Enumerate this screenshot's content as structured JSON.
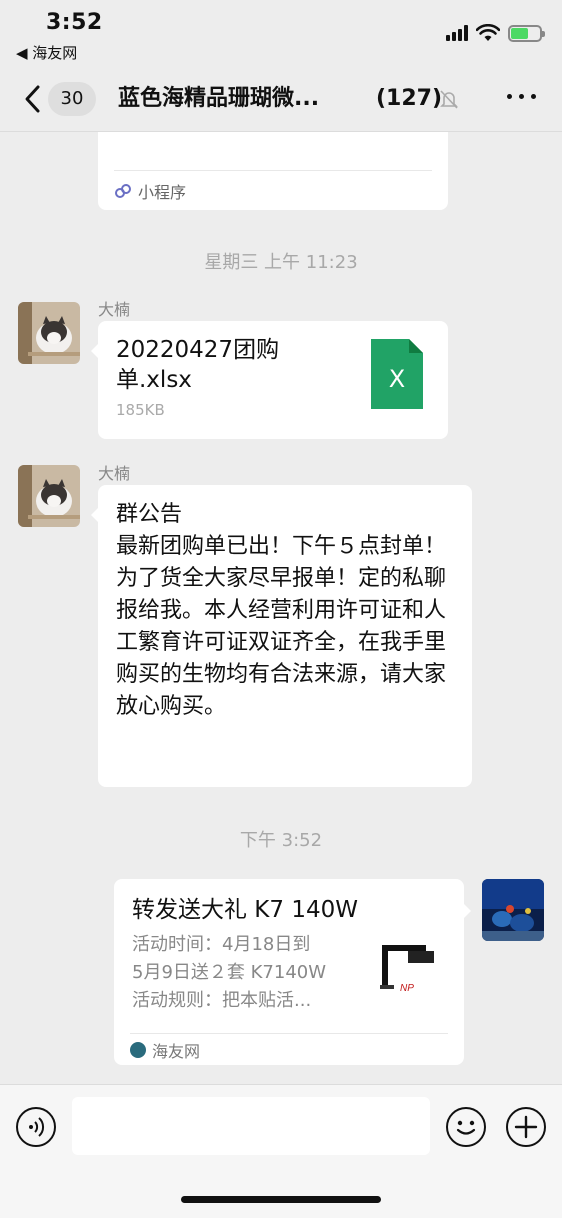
{
  "status_bar": {
    "time": "3:52",
    "back_app": "◀ 海友网"
  },
  "nav": {
    "unread_count": "30",
    "title": "蓝色海精品珊瑚微...",
    "member_count": "(127)"
  },
  "messages": {
    "mini_program_label": "小程序",
    "timestamp_1": "星期三 上午 11:23",
    "file_msg": {
      "sender": "大楠",
      "file_name": "20220427团购单.xlsx",
      "file_size": "185KB",
      "file_icon_letter": "X"
    },
    "notice_msg": {
      "sender": "大楠",
      "title": "群公告",
      "body": "最新团购单已出！下午５点封单！为了货全大家尽早报单！定的私聊报给我。本人经营利用许可证和人工繁育许可证双证齐全，在我手里购买的生物均有合法来源，请大家放心购买。"
    },
    "timestamp_2": "下午 3:52",
    "link_msg": {
      "title": "转发送大礼 K7 140W",
      "desc_line_1": "活动时间：4月18日到",
      "desc_line_2": "5月9日送２套 K7140W",
      "desc_line_3": "活动规则：把本贴活...",
      "source": "海友网"
    }
  },
  "colors": {
    "background": "#ededed",
    "bubble": "#ffffff",
    "excel_green": "#21a366",
    "battery_green": "#4cd964"
  }
}
